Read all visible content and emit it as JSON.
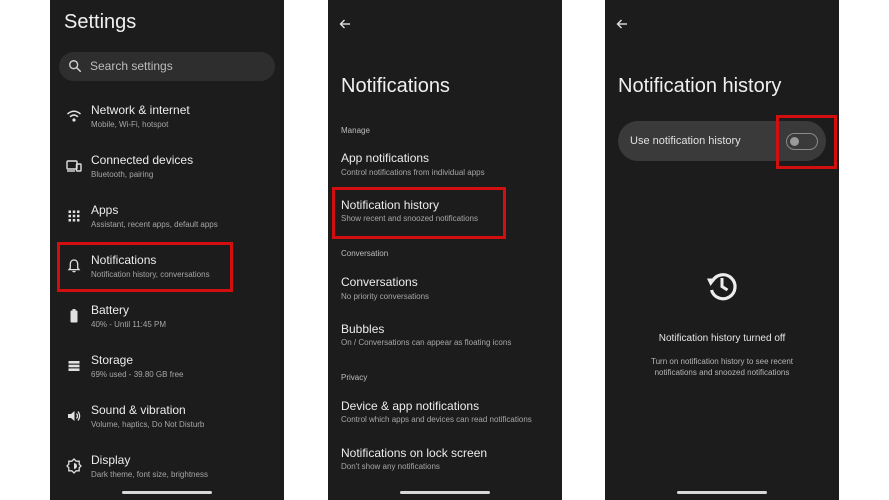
{
  "settings": {
    "title": "Settings",
    "search_placeholder": "Search settings",
    "items": [
      {
        "title": "Network & internet",
        "subtitle": "Mobile, Wi-Fi, hotspot",
        "icon": "wifi-icon"
      },
      {
        "title": "Connected devices",
        "subtitle": "Bluetooth, pairing",
        "icon": "devices-icon"
      },
      {
        "title": "Apps",
        "subtitle": "Assistant, recent apps, default apps",
        "icon": "apps-grid-icon"
      },
      {
        "title": "Notifications",
        "subtitle": "Notification history, conversations",
        "icon": "bell-icon"
      },
      {
        "title": "Battery",
        "subtitle": "40% - Until 11:45 PM",
        "icon": "battery-icon"
      },
      {
        "title": "Storage",
        "subtitle": "69% used - 39.80 GB free",
        "icon": "storage-icon"
      },
      {
        "title": "Sound & vibration",
        "subtitle": "Volume, haptics, Do Not Disturb",
        "icon": "volume-icon"
      },
      {
        "title": "Display",
        "subtitle": "Dark theme, font size, brightness",
        "icon": "brightness-icon"
      }
    ]
  },
  "notifications": {
    "title": "Notifications",
    "sections": {
      "manage": "Manage",
      "conversation": "Conversation",
      "privacy": "Privacy"
    },
    "items": {
      "app_notifications": {
        "title": "App notifications",
        "subtitle": "Control notifications from individual apps"
      },
      "notification_history": {
        "title": "Notification history",
        "subtitle": "Show recent and snoozed notifications"
      },
      "conversations": {
        "title": "Conversations",
        "subtitle": "No priority conversations"
      },
      "bubbles": {
        "title": "Bubbles",
        "subtitle": "On / Conversations can appear as floating icons"
      },
      "device_app_notifications": {
        "title": "Device & app notifications",
        "subtitle": "Control which apps and devices can read notifications"
      },
      "lock_screen": {
        "title": "Notifications on lock screen",
        "subtitle": "Don't show any notifications"
      }
    }
  },
  "history": {
    "title": "Notification history",
    "toggle_label": "Use notification history",
    "toggle_on": false,
    "empty_title": "Notification history turned off",
    "empty_desc": "Turn on notification history to see recent notifications and snoozed notifications"
  },
  "colors": {
    "background": "#1c1c1c",
    "highlight": "#d10f0f",
    "page": "#ffffff"
  }
}
